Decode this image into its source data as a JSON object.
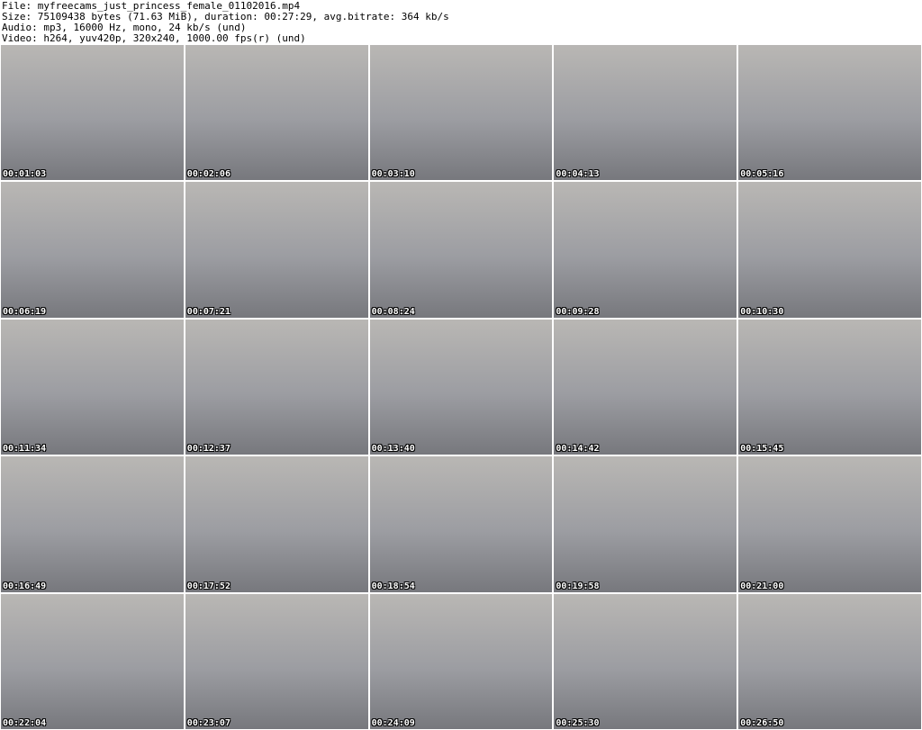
{
  "header": {
    "file": "File: myfreecams_just_princess_female_01102016.mp4",
    "size": "Size: 75109438 bytes (71.63 MiB), duration: 00:27:29, avg.bitrate: 364 kb/s",
    "audio": "Audio: mp3, 16000 Hz, mono, 24 kb/s (und)",
    "video": "Video: h264, yuv420p, 320x240, 1000.00 fps(r) (und)"
  },
  "timestamps": [
    "00:01:03",
    "00:02:06",
    "00:03:10",
    "00:04:13",
    "00:05:16",
    "00:06:19",
    "00:07:21",
    "00:08:24",
    "00:09:28",
    "00:10:30",
    "00:11:34",
    "00:12:37",
    "00:13:40",
    "00:14:42",
    "00:15:45",
    "00:16:49",
    "00:17:52",
    "00:18:54",
    "00:19:58",
    "00:21:00",
    "00:22:04",
    "00:23:07",
    "00:24:09",
    "00:25:30",
    "00:26:50"
  ]
}
